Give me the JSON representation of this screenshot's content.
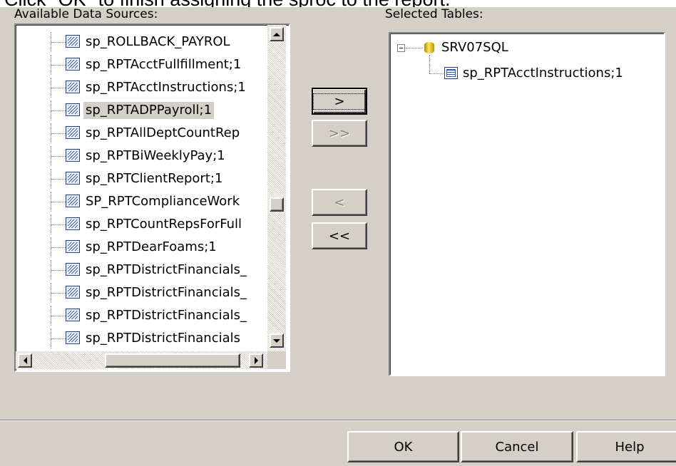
{
  "caption": "Click \"OK\" to finish assigning the sproc to the report.",
  "labels": {
    "available": "Available Data Sources:",
    "selected": "Selected Tables:"
  },
  "available_items": [
    {
      "label": "sp_ROLLBACK_PAYROL",
      "selected": false
    },
    {
      "label": "sp_RPTAcctFullfillment;1",
      "selected": false
    },
    {
      "label": "sp_RPTAcctInstructions;1",
      "selected": false
    },
    {
      "label": "sp_RPTADPPayroll;1",
      "selected": true
    },
    {
      "label": "sp_RPTAllDeptCountRep",
      "selected": false
    },
    {
      "label": "sp_RPTBiWeeklyPay;1",
      "selected": false
    },
    {
      "label": "sp_RPTClientReport;1",
      "selected": false
    },
    {
      "label": "SP_RPTComplianceWork",
      "selected": false
    },
    {
      "label": "sp_RPTCountRepsForFull",
      "selected": false
    },
    {
      "label": "sp_RPTDearFoams;1",
      "selected": false
    },
    {
      "label": "sp_RPTDistrictFinancials_",
      "selected": false
    },
    {
      "label": "sp_RPTDistrictFinancials_",
      "selected": false
    },
    {
      "label": "sp_RPTDistrictFinancials_",
      "selected": false
    },
    {
      "label": "sp_RPTDistrictFinancials",
      "selected": false
    }
  ],
  "selected_tree": {
    "server": "SRV07SQL",
    "children": [
      "sp_RPTAcctInstructions;1"
    ]
  },
  "transfer_buttons": {
    "add": ">",
    "add_all": ">>",
    "remove": "<",
    "remove_all": "<<"
  },
  "dialog_buttons": {
    "ok": "OK",
    "cancel": "Cancel",
    "help": "Help"
  }
}
